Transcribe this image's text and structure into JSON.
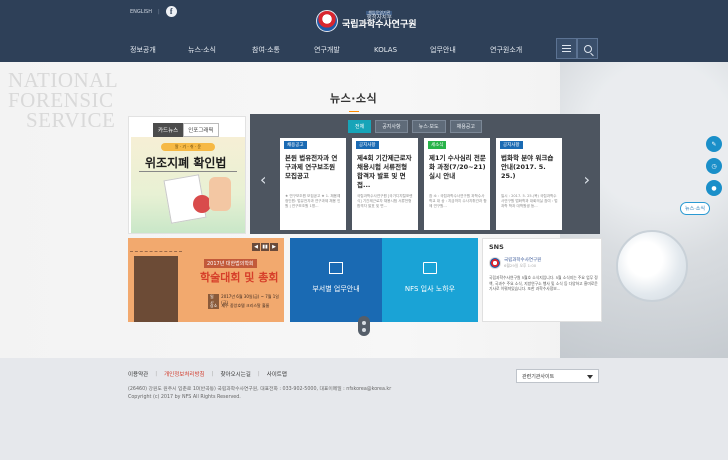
{
  "header": {
    "util_lang": "ENGLISH",
    "facebook_glyph": "f",
    "logo_badge": "책임운영기관",
    "logo_ministry": "행정자치부",
    "logo_name": "국립과학수사연구원",
    "menu": [
      "정보공개",
      "뉴스·소식",
      "참여·소통",
      "연구개발",
      "KOLAS",
      "업무안내",
      "연구원소개"
    ]
  },
  "main": {
    "bg_text": [
      "NATIONAL",
      "FORENSIC",
      "SERVICE"
    ],
    "section_title": "뉴스·소식",
    "cardnews": {
      "tabs": [
        "카드뉴스",
        "인포그래픽"
      ],
      "pill": "알 · 기 · 쉬 · 운",
      "headline": "위조지폐 확인법"
    },
    "news": {
      "tabs": [
        "전체",
        "공지사항",
        "뉴스·보도",
        "채용공고"
      ],
      "prev": "‹",
      "next": "›",
      "cards": [
        {
          "tag": "채용공고",
          "tag_color": "#1a6ab3",
          "title": "본원 법유전자과 연구과제 연구보조원 모집공고",
          "desc": "★ 연구보조원 모집공고 ★ 1. 채용예정인원: 법유전자과 연구과제 채용 인원 | 연구보조원 1명..."
        },
        {
          "tag": "공지사항",
          "tag_color": "#1a6ab3",
          "title": "제4회 기간제근로자 채용시험 서류전형 합격자 발표 및 면접...",
          "desc": "국립과학수사연구원 [국가디지털포렌식] 기간제근로자 채용시험 서류전형 합격자 발표 및 면..."
        },
        {
          "tag": "세소식",
          "tag_color": "#29b34a",
          "title": "제1기 수사심리 전문화 과정(7/20~21) 실시 안내",
          "desc": "참 소 : 국립과학수사연구원 과학수사학교 대 상 : 지금까지 수사지휘관과 함께 연구원..."
        },
        {
          "tag": "공지사항",
          "tag_color": "#1a6ab3",
          "title": "법화학 분야 워크숍 안내(2017. 5. 25.)",
          "desc": "일시 : 2017. 5. 25.(목) 국립과학수사연구원 법화학과 대회의실 참여 : 법과학 학과 대학원생 등..."
        }
      ]
    },
    "event": {
      "sub": "2017년 대한법의학회",
      "title": "학술대회 및 총회",
      "date_label": "일시",
      "date": "2017년 6월 30일(금) ~ 7월 1일(금)",
      "place_label": "장소",
      "place": "제주 중앙호텔 크리스탈 홀룸",
      "prev": "◀",
      "pause": "▮▮",
      "next": "▶"
    },
    "links": [
      {
        "label": "부서별 업무안내"
      },
      {
        "label": "NFS 입사 노하우"
      }
    ],
    "sns": {
      "heading": "SNS",
      "account": "국립과학수사연구원",
      "time": "6월29일 오후 1:00",
      "body": "국립과학수사연구원 5월호 소식지입니다. 5월 소식지는 주요 업무 정책, 국과수 주요 소식, 지방연구소 행사 및 소식 등 다양하고 흥미로운 기사로 이뤄져있습니다. 또한 과학수사정보..."
    },
    "quick_label": "뉴스·소식"
  },
  "footer": {
    "links": [
      "이용약관",
      "개인정보처리방침",
      "찾아오시는길",
      "사이트맵"
    ],
    "address": "(26460) 강원도 원주시 입춘로 10(반곡동) 국립과학수사연구원, 대표전화 : 033-902-5000, 대표이메일 : nfskorea@korea.kr",
    "copyright": "Copyright (c) 2017 by NFS All Rights Reserved.",
    "related_site": "관련기관사이트"
  },
  "colors": {
    "header_bg": "#2e4058",
    "accent_blue": "#1a6ab3",
    "accent_sky": "#1aa3d6",
    "accent_teal": "#17a4b8",
    "event_bg": "#f2a96e",
    "footer_bg": "#e6e8ec"
  }
}
